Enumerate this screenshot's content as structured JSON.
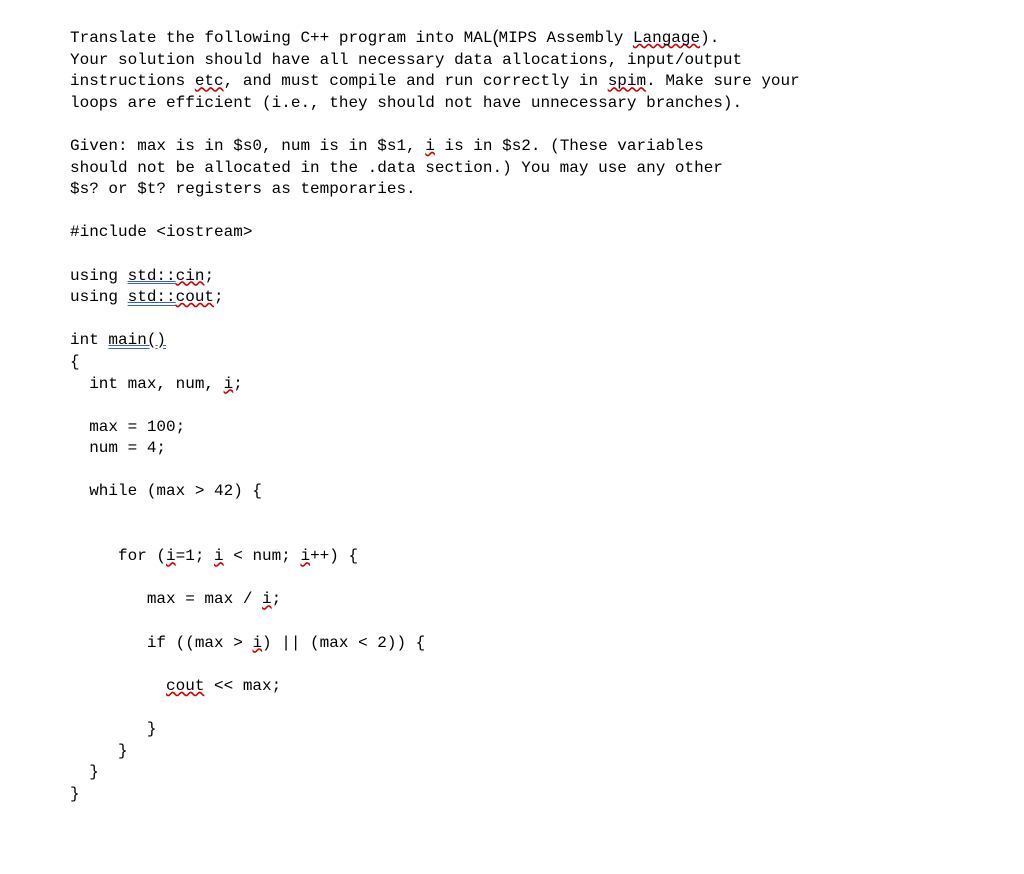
{
  "intro": {
    "l1a": "Translate the following C++ program into MAL",
    "l1b": "MIPS Assembly ",
    "l1c": "Langage",
    "l1d": ").",
    "l2": "Your solution should have all necessary data allocations, input/output",
    "l3a": "instructions ",
    "l3b": "etc",
    "l3c": ", and must compile and run correctly in ",
    "l3d": "spim",
    "l3e": ". Make sure your",
    "l4": "loops are efficient (i.e., they should not have unnecessary branches)."
  },
  "given": {
    "g1a": "Given: max is in $s0, num is in $s1, ",
    "g1b": "i",
    "g1c": " is in $s2. (These variables",
    "g2": "should not be allocated in the .data section.) You may use any other",
    "g3": "$s? or $t? registers as temporaries."
  },
  "code": {
    "inc": "#include <iostream>",
    "u1a": "using ",
    "u1b": "std::",
    "u1c": "cin",
    "u1d": ";",
    "u2a": "using ",
    "u2b": "std::",
    "u2c": "cout",
    "u2d": ";",
    "m1a": "int ",
    "m1b": "main()",
    "m2": "{",
    "m3a": "  int max, num, ",
    "m3b": "i",
    "m3c": ";",
    "m4": "  max = 100;",
    "m5": "  num = 4;",
    "m6": "  while (max > 42) {",
    "m7a": "     for (",
    "m7b": "i",
    "m7c": "=1; ",
    "m7d": "i",
    "m7e": " < num; ",
    "m7f": "i",
    "m7g": "++) {",
    "m8a": "        max = max / ",
    "m8b": "i",
    "m8c": ";",
    "m9a": "        if ((max > ",
    "m9b": "i",
    "m9c": ") || (max < 2)) {",
    "m10a": "          ",
    "m10b": "cout",
    "m10c": " << max;",
    "m11": "        }",
    "m12": "     }",
    "m13": "  }",
    "m14": "}"
  }
}
